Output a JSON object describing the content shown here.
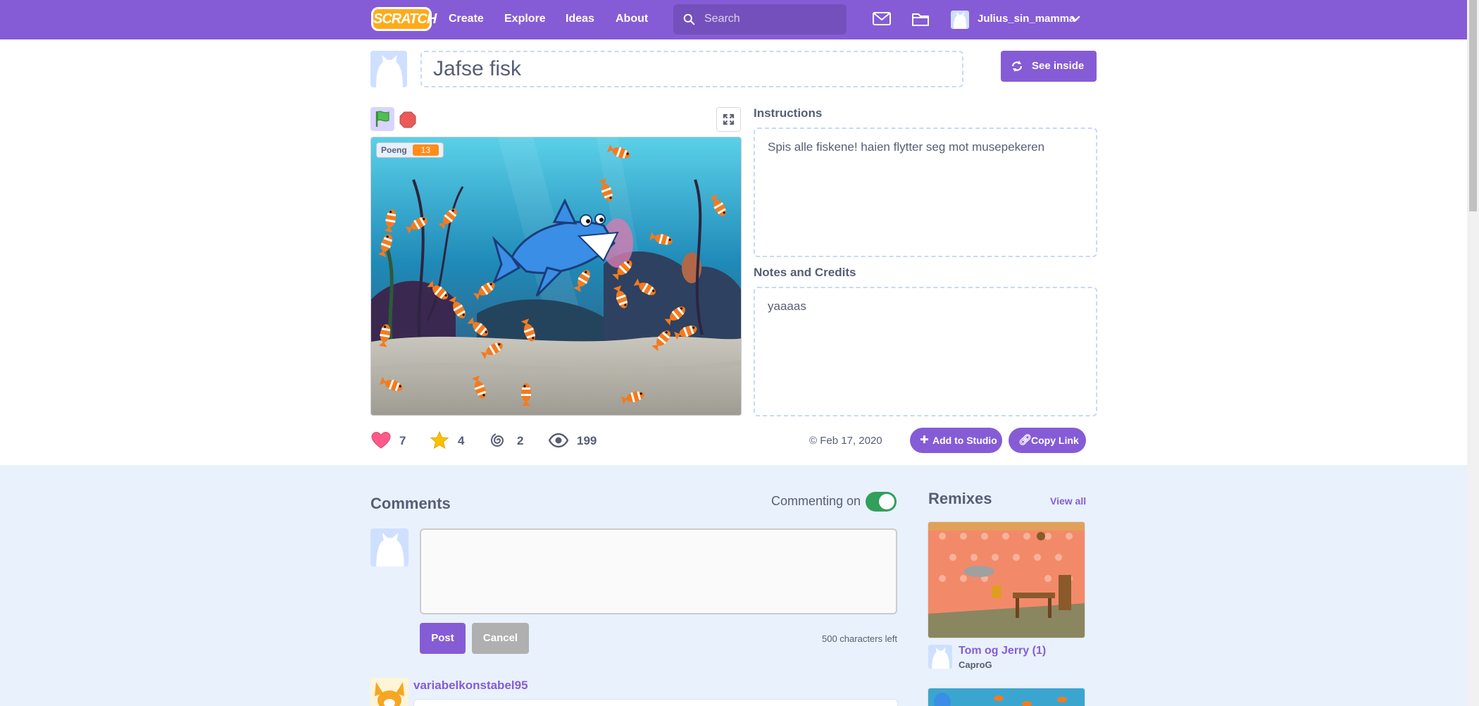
{
  "nav": {
    "logo": "SCRATCH",
    "links": [
      "Create",
      "Explore",
      "Ideas",
      "About"
    ],
    "search_placeholder": "Search",
    "username": "Julius_sin_mamma"
  },
  "project": {
    "title": "Jafse fisk",
    "see_inside_label": "See inside",
    "variable_name": "Poeng",
    "variable_value": "13",
    "instructions_label": "Instructions",
    "instructions_text": "Spis alle fiskene! haien flytter seg mot musepekeren",
    "notes_label": "Notes and Credits",
    "notes_text": "yaaaas"
  },
  "stats": {
    "loves": "7",
    "favorites": "4",
    "remixes": "2",
    "views": "199",
    "share_date": "Feb 17, 2020"
  },
  "actions": {
    "add_to_studio": "Add to Studio",
    "copy_link": "Copy Link"
  },
  "comments": {
    "title": "Comments",
    "commenting_status": "Commenting on",
    "commenting_enabled": true,
    "post_label": "Post",
    "cancel_label": "Cancel",
    "chars_left": "500 characters left",
    "first_commenter": "variabelkonstabel95"
  },
  "remixes": {
    "title": "Remixes",
    "view_all": "View all",
    "items": [
      {
        "title": "Tom og Jerry (1)",
        "author": "CaproG"
      }
    ]
  },
  "colors": {
    "brand": "#855cd6",
    "accent_orange": "#ff8c1a",
    "toggle_on": "#329f5b",
    "lower_background": "#e9f1fc"
  },
  "icons": [
    "search-icon",
    "mail-icon",
    "folder-icon",
    "chevron-down-icon",
    "green-flag-icon",
    "stop-icon",
    "fullscreen-icon",
    "heart-icon",
    "star-icon",
    "remix-swirl-icon",
    "eye-icon",
    "remix-arrows-icon",
    "plus-icon",
    "link-icon"
  ]
}
